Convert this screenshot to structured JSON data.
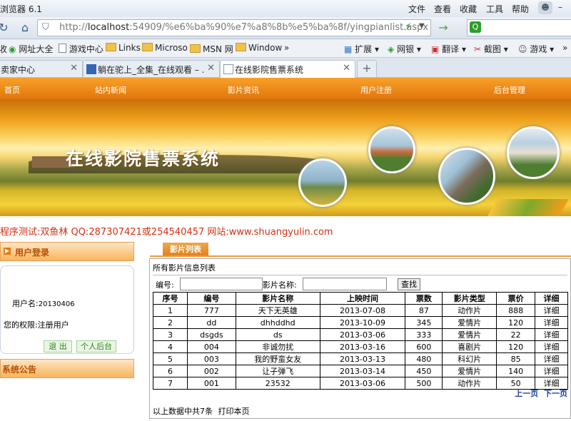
{
  "browser": {
    "title": "浏览器 6.1",
    "menu": [
      "文件",
      "查看",
      "收藏",
      "工具",
      "帮助"
    ],
    "url_host": "localhost",
    "url_rest": ":54909/%e6%ba%90%e7%a8%8b%e5%ba%8f/yingpianlist.aspx",
    "bookmarks": [
      "收",
      "网址大全",
      "游戏中心",
      "Links",
      "Microso",
      "MSN 网",
      "Window",
      "»"
    ],
    "toolbar_right": [
      "扩展",
      "网银",
      "翻译",
      "截图",
      "游戏"
    ],
    "tabs": [
      {
        "label": "卖家中心",
        "active": false
      },
      {
        "label": "躺在驼上_全集_在线观看 – ...",
        "active": false
      },
      {
        "label": "在线影院售票系统",
        "active": true
      }
    ]
  },
  "nav": [
    "首页",
    "站内新闻",
    "影片资讯",
    "用户注册",
    "后台管理"
  ],
  "banner": {
    "title": "在线影院售票系统"
  },
  "marquee": "程序测试:双鱼林 QQ:287307421或254540457 网站:www.shuangyulin.com",
  "sidebar": {
    "login_header": "用户登录",
    "username_label": "用户名:",
    "username": "20130406",
    "role_label": "您的权限:",
    "role": "注册用户",
    "logout": "退 出",
    "personal": "个人后台",
    "notice_header": "系统公告"
  },
  "content": {
    "tab_label": "影片列表",
    "panel_title": "所有影片信息列表",
    "search": {
      "code_label": "编号:",
      "name_label": "影片名称:",
      "button": "查找"
    },
    "columns": [
      "序号",
      "编号",
      "影片名称",
      "上映时间",
      "票数",
      "影片类型",
      "票价",
      "详细"
    ],
    "rows": [
      [
        "1",
        "777",
        "天下无英雄",
        "2013-07-08",
        "87",
        "动作片",
        "888",
        "详细"
      ],
      [
        "2",
        "dd",
        "dhhddhd",
        "2013-10-09",
        "345",
        "爱情片",
        "120",
        "详细"
      ],
      [
        "3",
        "dsgds",
        "ds",
        "2013-03-06",
        "333",
        "爱情片",
        "22",
        "详细"
      ],
      [
        "4",
        "004",
        "非诚勿扰",
        "2013-03-16",
        "600",
        "喜剧片",
        "120",
        "详细"
      ],
      [
        "5",
        "003",
        "我的野蛮女友",
        "2013-03-13",
        "480",
        "科幻片",
        "85",
        "详细"
      ],
      [
        "6",
        "002",
        "让子弹飞",
        "2013-03-14",
        "450",
        "爱情片",
        "140",
        "详细"
      ],
      [
        "7",
        "001",
        "23532",
        "2013-03-06",
        "500",
        "动作片",
        "50",
        "详细"
      ]
    ],
    "prev": "上一页",
    "next": "下一页",
    "footer_total": "以上数据中共7条",
    "footer_print": "打印本页"
  },
  "colors": {
    "nav_orange": "#f08a1a",
    "marquee": "#d62f10",
    "pager": "#1a3d9c"
  }
}
